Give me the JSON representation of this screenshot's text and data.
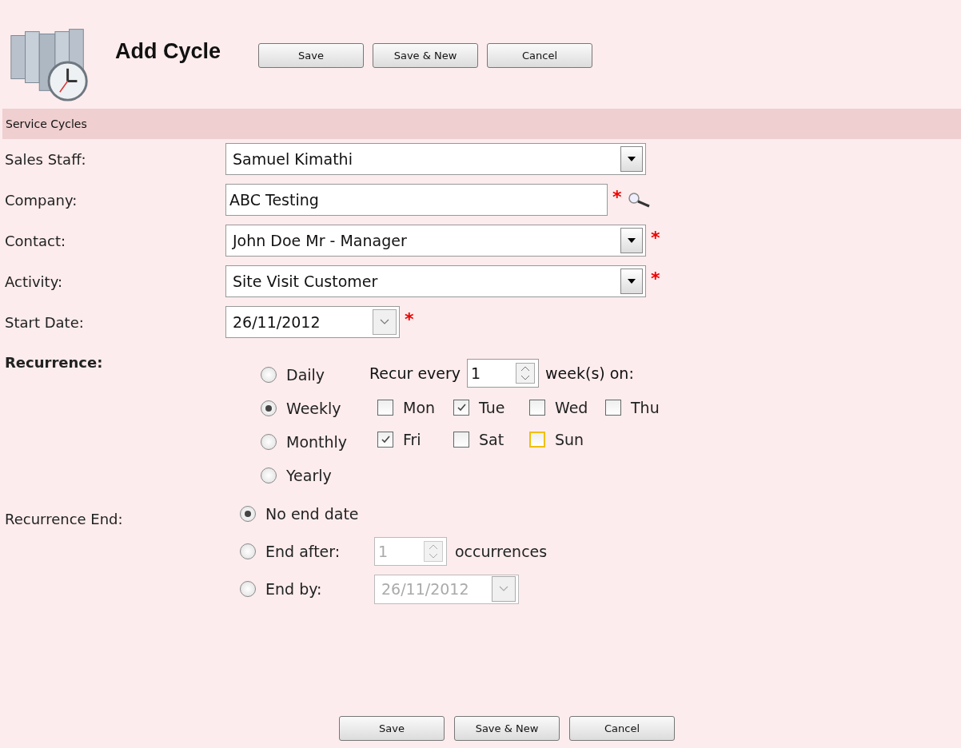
{
  "header": {
    "title": "Add Cycle",
    "buttons": [
      "Save",
      "Save & New",
      "Cancel"
    ]
  },
  "section": {
    "title": "Service Cycles"
  },
  "fields": [
    {
      "label": "Sales Staff:",
      "kind": "select",
      "value": "Samuel Kimathi",
      "lookup": false
    },
    {
      "label": "Company:",
      "kind": "text",
      "value": "ABC Testing",
      "required_mark": "*",
      "lookup": true
    },
    {
      "label": "Contact:",
      "kind": "select",
      "value": "John Doe Mr - Manager",
      "required_mark": "*",
      "lookup": false
    },
    {
      "label": "Activity:",
      "kind": "select",
      "value": "Site Visit Customer",
      "required_mark": "*",
      "lookup": false
    },
    {
      "label": "Start Date:",
      "kind": "date",
      "value": "26/11/2012",
      "required_mark": "*",
      "lookup": false
    }
  ],
  "recurrence": {
    "label": "Recurrence:",
    "patterns": [
      {
        "label": "Daily",
        "selected": false
      },
      {
        "label": "Weekly",
        "selected": true
      },
      {
        "label": "Monthly",
        "selected": false
      },
      {
        "label": "Yearly",
        "selected": false
      }
    ],
    "recur_every_label": "Recur every",
    "interval": "1",
    "unit_label": "week(s) on:",
    "days": [
      {
        "label": "Mon",
        "checked": false,
        "focused": false
      },
      {
        "label": "Tue",
        "checked": true,
        "focused": false
      },
      {
        "label": "Wed",
        "checked": false,
        "focused": false
      },
      {
        "label": "Thu",
        "checked": false,
        "focused": false
      },
      {
        "label": "Fri",
        "checked": true,
        "focused": false
      },
      {
        "label": "Sat",
        "checked": false,
        "focused": false
      },
      {
        "label": "Sun",
        "checked": false,
        "focused": true
      }
    ]
  },
  "recurrence_end": {
    "label": "Recurrence End:",
    "options": [
      {
        "kind": "none",
        "label": "No end date",
        "selected": true
      },
      {
        "kind": "count",
        "label": "End after:",
        "selected": false,
        "value": "1",
        "suffix": "occurrences",
        "disabled": true
      },
      {
        "kind": "date",
        "label": "End by:",
        "selected": false,
        "value": "26/11/2012",
        "disabled": true
      }
    ]
  },
  "footer": {
    "buttons": [
      "Save",
      "Save & New",
      "Cancel"
    ]
  }
}
